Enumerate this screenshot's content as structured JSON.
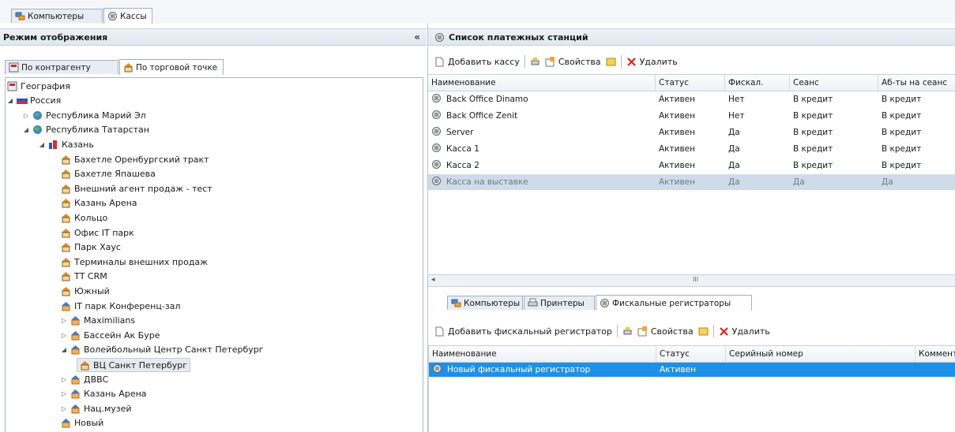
{
  "top_tabs": [
    {
      "label": "Компьютеры",
      "icon": "computers-icon"
    },
    {
      "label": "Кассы",
      "icon": "cash-register-icon"
    }
  ],
  "left": {
    "title": "Режим отображения",
    "collapse_glyph": "«",
    "subtabs": [
      {
        "label": "По контрагенту"
      },
      {
        "label": "По торговой точке"
      }
    ],
    "tree": [
      {
        "label": "География",
        "level": 0,
        "arrow": "",
        "icon": "globe-icon"
      },
      {
        "label": "Россия",
        "level": 0,
        "arrow": "◢",
        "icon": "flag-russia-icon"
      },
      {
        "label": "Республика Марий Эл",
        "level": 1,
        "arrow": "▷",
        "icon": "region-globe-icon"
      },
      {
        "label": "Республика Татарстан",
        "level": 1,
        "arrow": "◢",
        "icon": "region-globe-icon"
      },
      {
        "label": "Казань",
        "level": 2,
        "arrow": "◢",
        "icon": "city-icon"
      },
      {
        "label": "Бахетле Оренбургский тракт",
        "level": 3,
        "arrow": "",
        "icon": "shop-icon"
      },
      {
        "label": "Бахетле Япашева",
        "level": 3,
        "arrow": "",
        "icon": "shop-icon"
      },
      {
        "label": "Внешний агент продаж - тест",
        "level": 3,
        "arrow": "",
        "icon": "shop-icon"
      },
      {
        "label": "Казань Арена",
        "level": 3,
        "arrow": "",
        "icon": "shop-icon"
      },
      {
        "label": "Кольцо",
        "level": 3,
        "arrow": "",
        "icon": "shop-icon"
      },
      {
        "label": "Офис IT парк",
        "level": 3,
        "arrow": "",
        "icon": "shop-icon"
      },
      {
        "label": "Парк Хаус",
        "level": 3,
        "arrow": "",
        "icon": "shop-icon"
      },
      {
        "label": "Терминалы внешних продаж",
        "level": 3,
        "arrow": "",
        "icon": "shop-icon"
      },
      {
        "label": "ТТ CRM",
        "level": 3,
        "arrow": "",
        "icon": "shop-icon"
      },
      {
        "label": "Южный",
        "level": 3,
        "arrow": "",
        "icon": "shop-icon"
      },
      {
        "label": "IT парк Конференц-зал",
        "level": 3,
        "arrow": "",
        "icon": "venue-icon"
      },
      {
        "label": "Maximilians",
        "level": 3,
        "arrow": "▷",
        "icon": "venue-icon"
      },
      {
        "label": "Бассейн Ак Буре",
        "level": 3,
        "arrow": "▷",
        "icon": "venue-icon"
      },
      {
        "label": "Волейбольный Центр Санкт Петербург",
        "level": 3,
        "arrow": "◢",
        "icon": "venue-icon"
      },
      {
        "label": "ВЦ Санкт Петербург",
        "level": 4,
        "arrow": "",
        "icon": "shop-icon",
        "selected": true
      },
      {
        "label": "ДВВС",
        "level": 3,
        "arrow": "▷",
        "icon": "venue-icon"
      },
      {
        "label": "Казань Арена",
        "level": 3,
        "arrow": "▷",
        "icon": "venue-icon"
      },
      {
        "label": "Нац.музей",
        "level": 3,
        "arrow": "▷",
        "icon": "venue-icon"
      },
      {
        "label": "Новый",
        "level": 3,
        "arrow": "",
        "icon": "venue-icon"
      }
    ]
  },
  "stations": {
    "title": "Список платежных станций",
    "toolbar": {
      "add": "Добавить кассу",
      "props": "Свойства",
      "delete": "Удалить"
    },
    "columns": [
      "Наименование",
      "Статус",
      "Фискал.",
      "Сеанс",
      "Аб-ты на сеанс"
    ],
    "rows": [
      [
        "Back Office Dinamo",
        "Активен",
        "Нет",
        "В кредит",
        "В кредит"
      ],
      [
        "Back Office Zenit",
        "Активен",
        "Нет",
        "В кредит",
        "В кредит"
      ],
      [
        "Server",
        "Активен",
        "Да",
        "В кредит",
        "В кредит"
      ],
      [
        "Касса 1",
        "Активен",
        "Да",
        "В кредит",
        "В кредит"
      ],
      [
        "Касса 2",
        "Активен",
        "Да",
        "В кредит",
        "В кредит"
      ],
      [
        "Касса на выставке",
        "Активен",
        "Да",
        "Да",
        "Да"
      ]
    ],
    "selected_row": 5,
    "scroll_glyph": "III"
  },
  "bottom": {
    "tabs": [
      {
        "label": "Компьютеры",
        "icon": "computers-icon"
      },
      {
        "label": "Принтеры",
        "icon": "printer-icon"
      },
      {
        "label": "Фискальные регистраторы",
        "icon": "cash-register-icon"
      }
    ],
    "toolbar": {
      "add": "Добавить фискальный регистратор",
      "props": "Свойства",
      "delete": "Удалить"
    },
    "columns": [
      "Наименование",
      "Статус",
      "Серийный номер",
      "Коммент"
    ],
    "rows": [
      [
        "Новый фискальный регистратор",
        "Активен",
        "",
        ""
      ]
    ]
  },
  "colors": {
    "selection": "#1e90e6",
    "accent": "#c4302b"
  }
}
